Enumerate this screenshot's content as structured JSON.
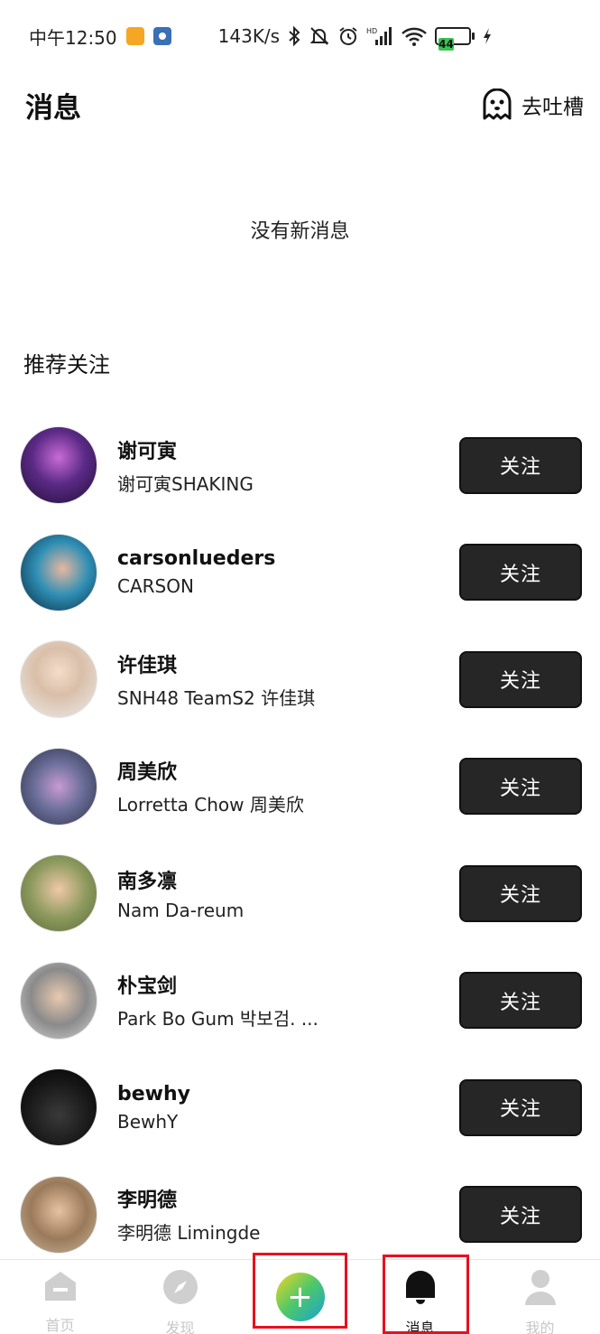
{
  "status_bar": {
    "time": "中午12:50",
    "net_speed": "143K/s",
    "battery_level": "44"
  },
  "header": {
    "title": "消息",
    "feedback_label": "去吐槽"
  },
  "empty_state": "没有新消息",
  "recommend": {
    "title": "推荐关注",
    "follow_label": "关注",
    "users": [
      {
        "name": "谢可寅",
        "sub": "谢可寅SHAKING"
      },
      {
        "name": "carsonlueders",
        "sub": "CARSON"
      },
      {
        "name": "许佳琪",
        "sub": "SNH48 TeamS2 许佳琪"
      },
      {
        "name": "周美欣",
        "sub": "Lorretta Chow 周美欣"
      },
      {
        "name": "南多凛",
        "sub": "Nam Da-reum"
      },
      {
        "name": "朴宝剑",
        "sub": "Park Bo Gum 박보검. ..."
      },
      {
        "name": "bewhy",
        "sub": "BewhY"
      },
      {
        "name": "李明德",
        "sub": "李明德 Limingde"
      }
    ]
  },
  "tabs": {
    "home": "首页",
    "discover": "发现",
    "create": "+",
    "messages": "消息",
    "mine": "我的"
  },
  "colors": {
    "button_bg": "#262626",
    "tab_inactive": "#c7c7c7",
    "highlight": "#e8101f"
  }
}
